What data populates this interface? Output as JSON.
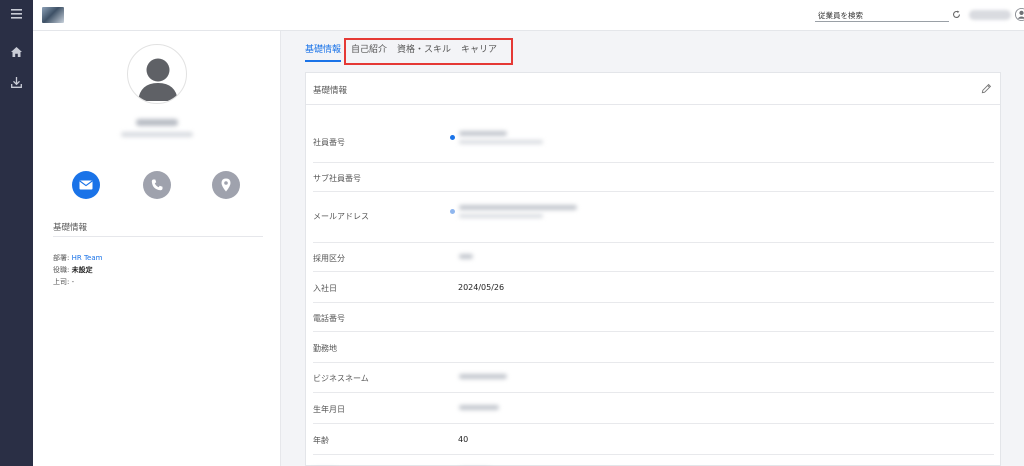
{
  "topbar": {
    "search_placeholder": "従業員を検索",
    "help_label": "?"
  },
  "profile": {
    "contact_colors": {
      "email": "#1a73e8",
      "phone": "#9fa2ad",
      "location": "#9fa2ad"
    },
    "basic_info_label": "基礎情報",
    "department_label": "部署:",
    "department_value": "HR Team",
    "position_label": "役職:",
    "position_value": "未設定",
    "manager_label": "上司:",
    "manager_value": "-"
  },
  "tabs": [
    {
      "label": "基礎情報",
      "active": true
    },
    {
      "label": "自己紹介",
      "active": false
    },
    {
      "label": "資格・スキル",
      "active": false
    },
    {
      "label": "キャリア",
      "active": false
    }
  ],
  "card": {
    "title": "基礎情報",
    "rows": [
      {
        "label": "社員番号",
        "value": ""
      },
      {
        "label": "サブ社員番号",
        "value": ""
      },
      {
        "label": "メールアドレス",
        "value": ""
      },
      {
        "label": "採用区分",
        "value": ""
      },
      {
        "label": "入社日",
        "value": "2024/05/26"
      },
      {
        "label": "電話番号",
        "value": ""
      },
      {
        "label": "勤務地",
        "value": ""
      },
      {
        "label": "ビジネスネーム",
        "value": ""
      },
      {
        "label": "生年月日",
        "value": ""
      },
      {
        "label": "年齢",
        "value": "40"
      }
    ]
  },
  "accent_color": "#1a73e8",
  "highlight_color": "#e53935"
}
